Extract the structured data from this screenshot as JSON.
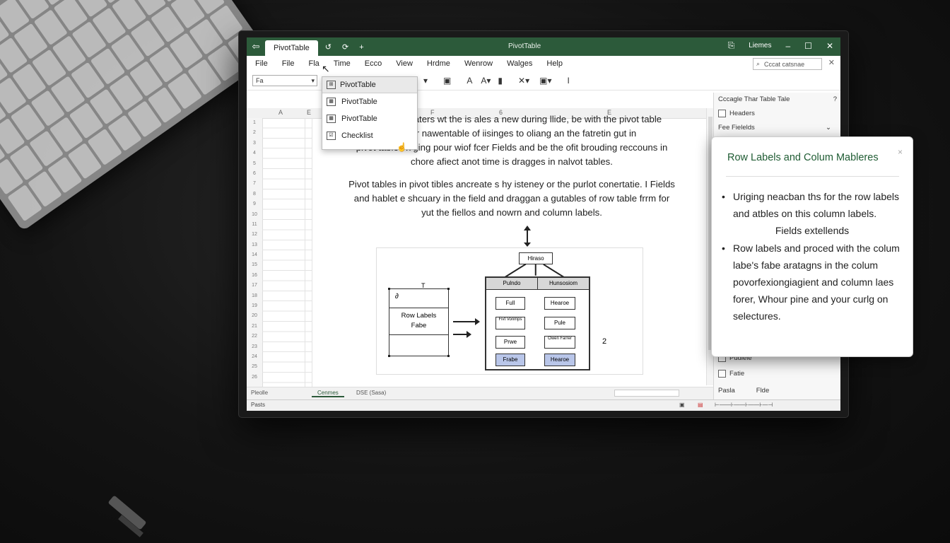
{
  "window": {
    "tab_label": "PivotTable",
    "tab_tools": "↺  ⟳  +",
    "title": "PivotTable",
    "account": "Liemes",
    "controls": [
      "⎘",
      "–",
      "☐",
      "✕"
    ]
  },
  "menu": {
    "items": [
      "File",
      "File",
      "Fla",
      "Time",
      "Ecco",
      "View",
      "Hrdme",
      "Wenrow",
      "Walges",
      "Help"
    ],
    "search_placeholder": "Cccat catsnae"
  },
  "toolbar": {
    "namebox_value": "Fa",
    "icons": [
      "▾",
      "▣",
      "A",
      "A▾",
      "▮",
      "✕▾",
      "▣▾",
      "I"
    ]
  },
  "columns": [
    "A",
    "E",
    "F",
    "6",
    "E"
  ],
  "rows": [
    "1",
    "2",
    "3",
    "4",
    "5",
    "6",
    "7",
    "8",
    "9",
    "10",
    "11",
    "12",
    "13",
    "14",
    "15",
    "16",
    "17",
    "18",
    "19",
    "20",
    "21",
    "22",
    "23",
    "24",
    "25",
    "26"
  ],
  "dropdown": {
    "header": "PivotTable",
    "items": [
      "PivotTable",
      "PivotTable",
      "Checklist"
    ]
  },
  "document": {
    "paragraph1": [
      "reaters wt the is ales a new during llide, be with the pivot table",
      "bur nawentable of iisinges to oliang an the fatretin gut in",
      "pivot tables n’ging pour wiof fcer Fields and be the ofit brouding reccouns in",
      "chore afiect anot time is dragges in nalvot tables."
    ],
    "paragraph2": [
      "Pivot tables in pivot tibles ancreate s hy isteney or the purlot conertatie. I Fields",
      "and hablet e shcuary in the field and draggan a gutables of row table frrm for",
      "yut the fiellos and nowrn and column labels."
    ]
  },
  "diagram": {
    "header_box": "Hiraso",
    "left_box_mark": "∂",
    "left_box_label": "Row Labels",
    "left_box_sub": "Fabe",
    "table_headers": [
      "Pulndo",
      "Hunsosiom"
    ],
    "cells": [
      "Full",
      "Fivt Vonmps",
      "Prwe",
      "Frabe",
      "Hearoe",
      "Pule",
      "Owen Farrer",
      "Hearoe"
    ],
    "number": "2",
    "tick": "T"
  },
  "sheet": {
    "tabs": [
      "Pleolle",
      "Cenmes",
      "DSE (Sasa)"
    ],
    "status": "Pasts"
  },
  "side_pane": {
    "title": "Cccagle Thar Table Tale",
    "help": "?",
    "rows": [
      "Headers",
      "Fee Fielelds",
      "Pudlele",
      "Fatie"
    ],
    "footer_left": "Pasla",
    "footer_right": "Flde"
  },
  "popup": {
    "title": "Row Labels and Colum Mableres",
    "bullet1": "Uriging neacban ths for the row labels and atbles on this column labels.",
    "subheading": "Fields extellends",
    "bullet2": "Row labels and proced with the colum labe's fabe aratagns in the colum povorfexiongiagient and column laes forer, Whour pine and your curlg on selectures."
  },
  "colors": {
    "titlebar": "#2c5a3a",
    "accent": "#1f5c33",
    "highlight": "#b9c6e9"
  }
}
